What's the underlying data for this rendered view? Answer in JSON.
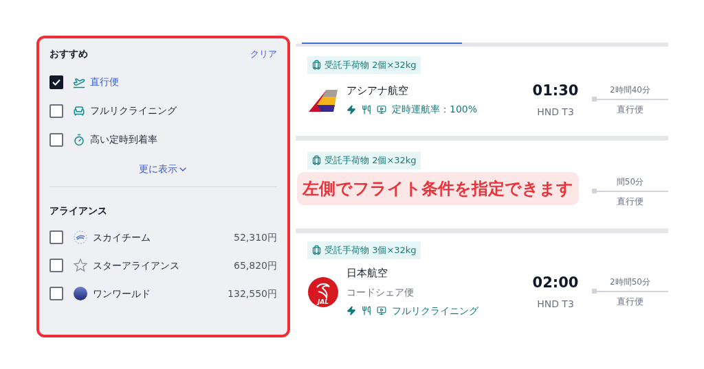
{
  "filters": {
    "recommended": {
      "title": "おすすめ",
      "clear": "クリア",
      "items": [
        {
          "kind": "nonstop",
          "label": "直行便",
          "checked": true
        },
        {
          "kind": "seat",
          "label": "フルリクライニング",
          "checked": false
        },
        {
          "kind": "ontime",
          "label": "高い定時到着率",
          "checked": false
        }
      ],
      "more": "更に表示"
    },
    "alliances": {
      "title": "アライアンス",
      "items": [
        {
          "kind": "skyteam",
          "label": "スカイチーム",
          "price": "52,310円",
          "checked": false
        },
        {
          "kind": "star",
          "label": "スターアライアンス",
          "price": "65,820円",
          "checked": false
        },
        {
          "kind": "oneworld",
          "label": "ワンワールド",
          "price": "132,550円",
          "checked": false
        }
      ]
    }
  },
  "results": [
    {
      "baggage": "受託手荷物 2個×32kg",
      "kind": "asiana",
      "airline": "アシアナ航空",
      "feature": "定時運航率：100%",
      "time": "01:30",
      "terminal": "HND T3",
      "duration": "2時間40分",
      "stops": "直行便"
    },
    {
      "baggage": "受託手荷物 2個×32kg",
      "duration": "間50分",
      "stops": "直行便"
    },
    {
      "baggage": "受託手荷物 3個×32kg",
      "kind": "jal",
      "logo_text": "JAL",
      "airline": "日本航空",
      "codeshare": "コードシェア便",
      "feature": "フルリクライニング",
      "time": "02:00",
      "terminal": "HND T3",
      "duration": "2時間50分",
      "stops": "直行便"
    }
  ],
  "callout": "左側でフライト条件を指定できます"
}
